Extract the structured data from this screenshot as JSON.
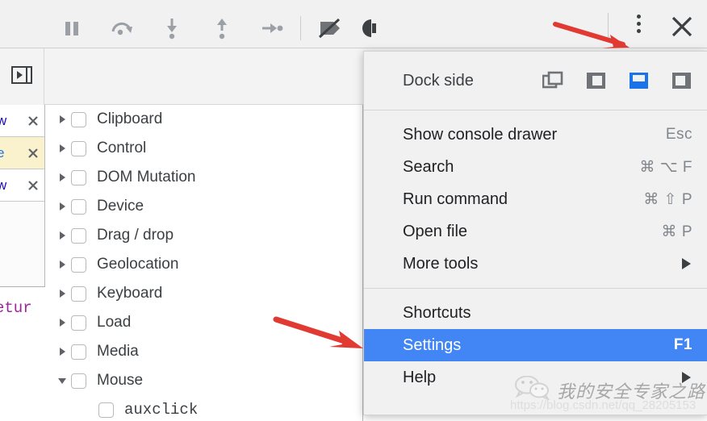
{
  "titlebar": {
    "kebab_icon": "kebab-menu-icon",
    "close_icon": "close-icon"
  },
  "toolbar": {
    "buttons": [
      {
        "name": "show-navigator-button",
        "icon": "show-navigator-icon"
      },
      {
        "name": "pause-button",
        "icon": "pause-icon"
      },
      {
        "name": "step-over-button",
        "icon": "step-over-icon"
      },
      {
        "name": "step-into-button",
        "icon": "step-into-icon"
      },
      {
        "name": "step-out-button",
        "icon": "step-out-icon"
      },
      {
        "name": "step-button",
        "icon": "step-icon"
      },
      {
        "name": "deactivate-breakpoints-button",
        "icon": "deactivate-breakpoints-icon"
      },
      {
        "name": "pause-on-exceptions-button",
        "icon": "pause-on-exceptions-icon"
      }
    ]
  },
  "left_strip": {
    "rows": [
      {
        "text": "w",
        "highlighted": false
      },
      {
        "text": "e",
        "highlighted": true
      },
      {
        "text": "w",
        "highlighted": false
      }
    ],
    "code_fragment": "etur"
  },
  "tree": {
    "items": [
      {
        "label": "Clipboard",
        "expanded": false,
        "checked": false,
        "child": false
      },
      {
        "label": "Control",
        "expanded": false,
        "checked": false,
        "child": false
      },
      {
        "label": "DOM Mutation",
        "expanded": false,
        "checked": false,
        "child": false
      },
      {
        "label": "Device",
        "expanded": false,
        "checked": false,
        "child": false
      },
      {
        "label": "Drag / drop",
        "expanded": false,
        "checked": false,
        "child": false
      },
      {
        "label": "Geolocation",
        "expanded": false,
        "checked": false,
        "child": false
      },
      {
        "label": "Keyboard",
        "expanded": false,
        "checked": false,
        "child": false
      },
      {
        "label": "Load",
        "expanded": false,
        "checked": false,
        "child": false
      },
      {
        "label": "Media",
        "expanded": false,
        "checked": false,
        "child": false
      },
      {
        "label": "Mouse",
        "expanded": true,
        "checked": false,
        "child": false
      },
      {
        "label": "auxclick",
        "expanded": null,
        "checked": false,
        "child": true
      }
    ]
  },
  "menu": {
    "dock": {
      "label": "Dock side",
      "options": [
        {
          "name": "undock-into-separate-window",
          "active": false
        },
        {
          "name": "dock-to-left",
          "active": false
        },
        {
          "name": "dock-to-bottom",
          "active": true
        },
        {
          "name": "dock-to-right",
          "active": false
        }
      ],
      "active_color": "#1a73e8"
    },
    "items": [
      {
        "label": "Show console drawer",
        "shortcut": "Esc",
        "selected": false,
        "submenu": false
      },
      {
        "label": "Search",
        "shortcut": "⌘ ⌥ F",
        "selected": false,
        "submenu": false
      },
      {
        "label": "Run command",
        "shortcut": "⌘ ⇧ P",
        "selected": false,
        "submenu": false
      },
      {
        "label": "Open file",
        "shortcut": "⌘ P",
        "selected": false,
        "submenu": false
      },
      {
        "label": "More tools",
        "shortcut": "",
        "selected": false,
        "submenu": true
      },
      {
        "label": "Shortcuts",
        "shortcut": "",
        "selected": false,
        "submenu": false
      },
      {
        "label": "Settings",
        "shortcut": "F1",
        "selected": true,
        "submenu": false
      },
      {
        "label": "Help",
        "shortcut": "",
        "selected": false,
        "submenu": true
      }
    ],
    "selected_bg": "#4285f4"
  },
  "annotations": {
    "arrow_color": "#e03a32",
    "arrows": [
      {
        "name": "annotation-arrow-to-kebab-menu",
        "target": "kebab-menu-icon"
      },
      {
        "name": "annotation-arrow-to-settings",
        "target": "settings-menu-item"
      }
    ]
  },
  "watermark": {
    "text": "我的安全专家之路",
    "url": "https://blog.csdn.net/qq_28205153",
    "logo": "wechat-icon"
  }
}
